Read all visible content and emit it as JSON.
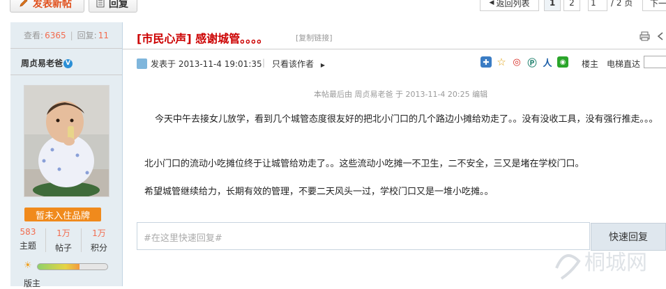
{
  "toolbar": {
    "new_post_label": "发表新帖",
    "reply_label": "回复",
    "back_label": "返回列表",
    "pages": [
      "1",
      "2"
    ],
    "page_input_value": "1",
    "page_total": "/ 2 页",
    "next_label": "下一"
  },
  "stats": {
    "views_label": "查看:",
    "views_value": "6365",
    "sep": "|",
    "replies_label": "回复:",
    "replies_value": "11"
  },
  "author": {
    "name": "周贞易老爸",
    "verified_badge": "V",
    "brand_label": "暂未入住品牌",
    "topics_value": "583",
    "topics_label": "主题",
    "posts_value": "1万",
    "posts_label": "帖子",
    "points_value": "1万",
    "points_label": "积分",
    "level_progress": 0.6,
    "rank": "版主"
  },
  "post": {
    "title": "[市民心声] 感谢城管。。。。",
    "copy_link": "[复制链接]",
    "posted_at": "发表于 2013-11-4 19:01:35",
    "sep": "|",
    "only_author": "只看该作者",
    "floor_label": "楼主",
    "elevator_label": "电梯直达",
    "edit_note": "本帖最后由 周贞易老爸 于 2013-11-4 20:25 编辑",
    "paragraphs": [
      "今天中午去接女儿放学，看到几个城管态度很友好的把北小门口的几个路边小摊给劝走了。。没有没收工具，没有强行推走。。。",
      "北小门口的流动小吃摊位终于让城管给劝走了。。这些流动小吃摊一不卫生，二不安全，三又是堵在学校门口。",
      "希望城管继续给力，长期有效的管理，不要二天风头一过，学校门口又是一堆小吃摊。。"
    ]
  },
  "reply": {
    "placeholder": "#在这里快速回复#",
    "button_label": "快速回复"
  },
  "icons": [
    "pencil-icon",
    "reply-icon",
    "print-icon",
    "prev-icon",
    "avatar-icon",
    "arrow-right-icon",
    "share-add-icon",
    "star-icon",
    "weibo-icon",
    "pengyou-icon",
    "renren-icon",
    "wechat-icon"
  ],
  "colors": {
    "title_red": "#cc0000",
    "accent_orange": "#f26c4f",
    "brand_orange": "#f08a1c",
    "sidebar_bg": "#e5edf2"
  },
  "watermark": "桐城网"
}
